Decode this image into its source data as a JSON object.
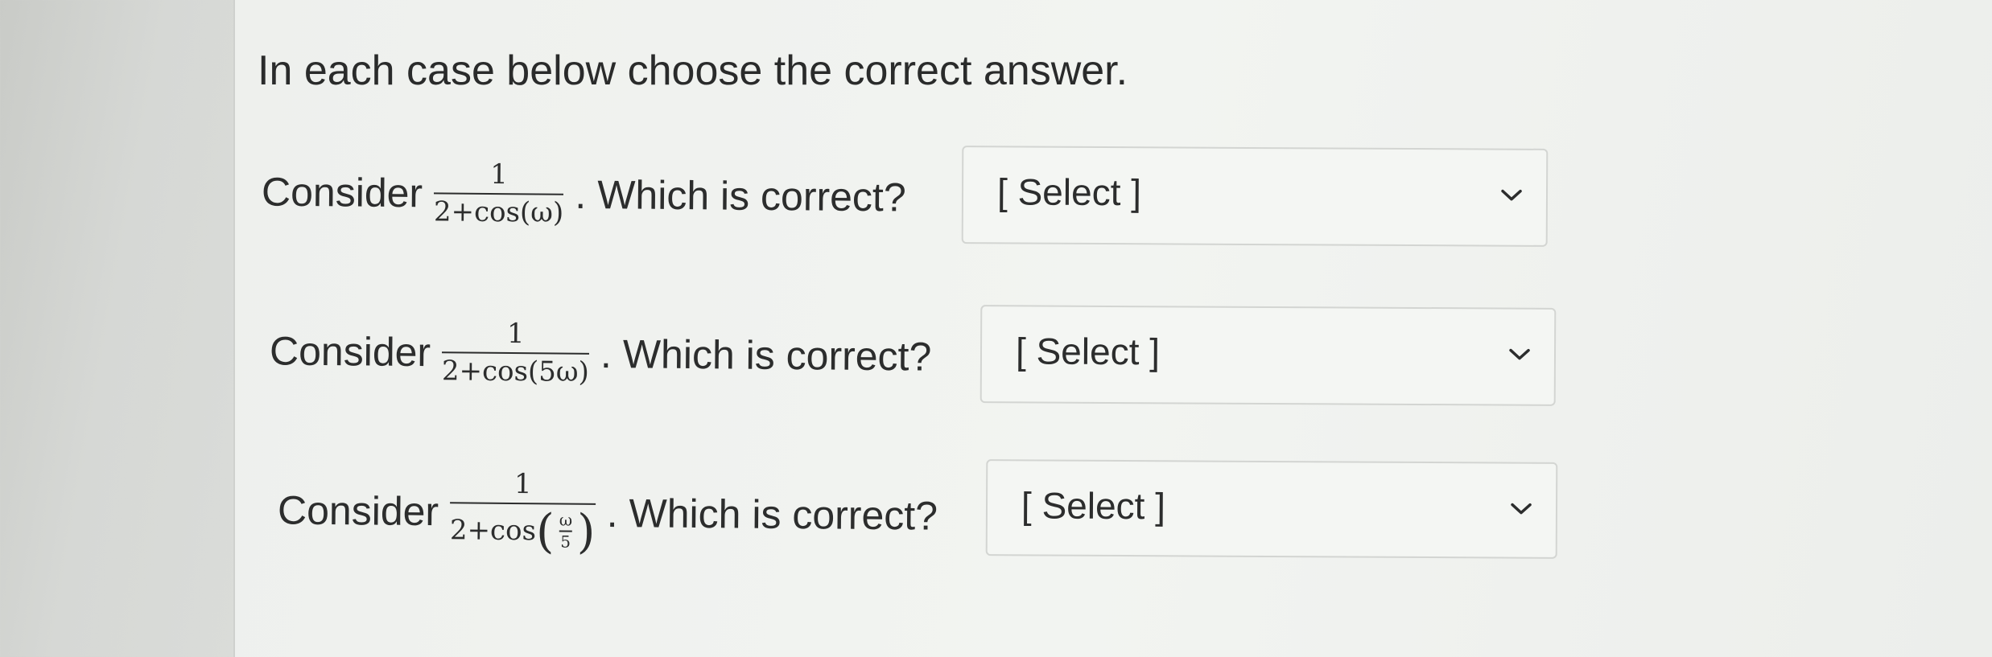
{
  "instructions": "In each case below choose the correct answer.",
  "questions": [
    {
      "prefix": "Consider",
      "numerator": "1",
      "denominator": "2+cos(ω)",
      "suffix": ". Which is correct?",
      "select_value": "[ Select ]"
    },
    {
      "prefix": "Consider",
      "numerator": "1",
      "denominator": "2+cos(5ω)",
      "suffix": ". Which is correct?",
      "select_value": "[ Select ]"
    },
    {
      "prefix": "Consider",
      "numerator": "1",
      "denominator_prefix": "2+cos",
      "inner_numerator": "ω",
      "inner_denominator": "5",
      "suffix": ". Which is correct?",
      "select_value": "[ Select ]"
    }
  ],
  "icons": {
    "dropdown": "chevron-down-icon"
  },
  "colors": {
    "text": "#2c2d2d",
    "select_background": "#f4f6f3",
    "select_border": "#d3d5d2"
  }
}
